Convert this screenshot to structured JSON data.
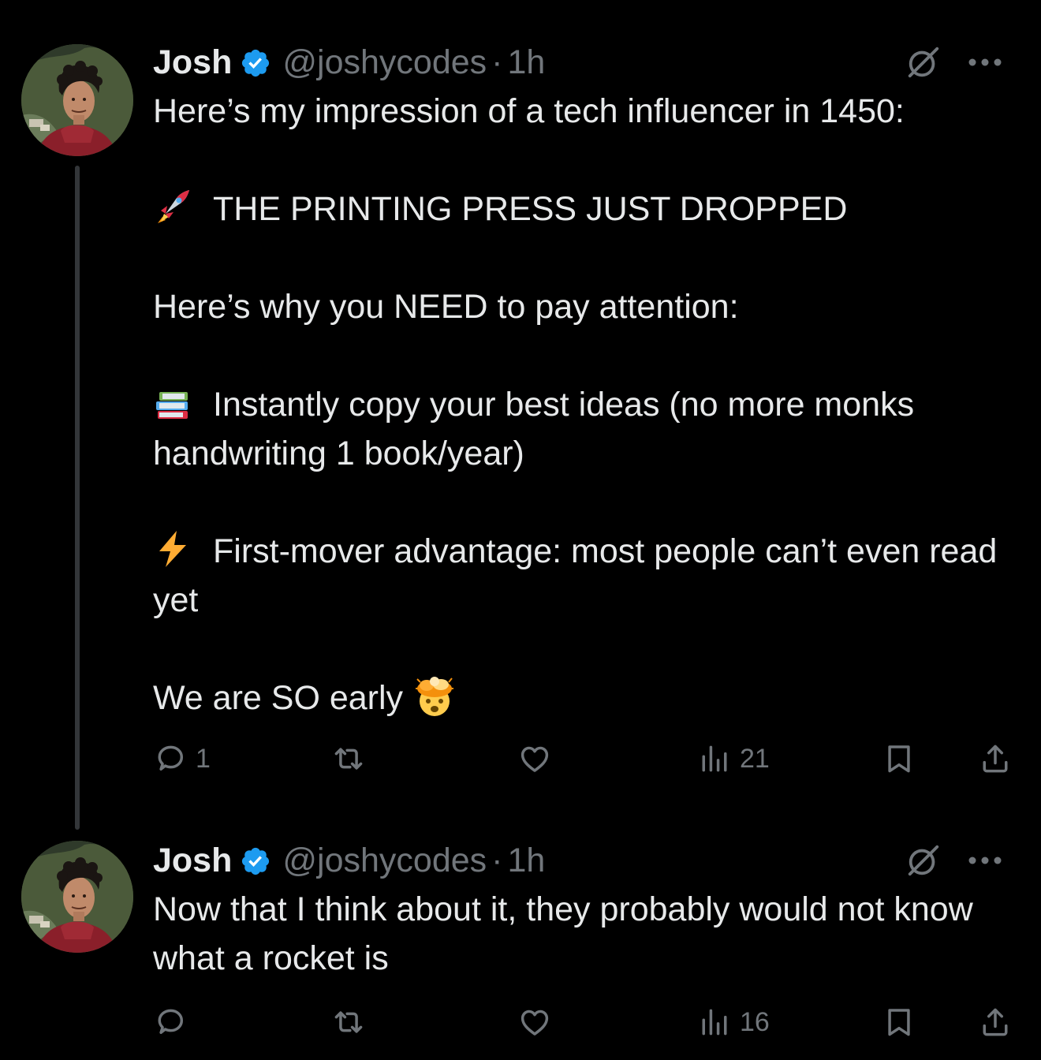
{
  "colors": {
    "background": "#000000",
    "text": "#e7e9ea",
    "secondary": "#71767b",
    "verified": "#1d9bf0",
    "thread_line": "#333639"
  },
  "tweets": [
    {
      "author": {
        "name": "Josh",
        "handle": "@joshycodes",
        "separator": "·",
        "time": "1h"
      },
      "paragraphs": [
        {
          "emoji": null,
          "text": "Here’s my impression of a tech influencer in 1450:"
        },
        {
          "emoji": "rocket-emoji",
          "text": "THE PRINTING PRESS JUST DROPPED"
        },
        {
          "emoji": null,
          "text": "Here’s why you NEED to pay attention:"
        },
        {
          "emoji": "books-emoji",
          "text": "Instantly copy your best ideas (no more monks handwriting 1 book/year)"
        },
        {
          "emoji": "lightning-emoji",
          "text": "First-mover advantage: most people can’t even read yet"
        },
        {
          "emoji": null,
          "text": "We are SO early",
          "trailing_emoji": "exploding-head-emoji"
        }
      ],
      "stats": {
        "replies": "1",
        "reposts": "",
        "likes": "",
        "views": "21"
      }
    },
    {
      "author": {
        "name": "Josh",
        "handle": "@joshycodes",
        "separator": "·",
        "time": "1h"
      },
      "paragraphs": [
        {
          "emoji": null,
          "text": "Now that I think about it, they probably would not know what a rocket is"
        }
      ],
      "stats": {
        "replies": "",
        "reposts": "",
        "likes": "",
        "views": "16"
      }
    }
  ]
}
